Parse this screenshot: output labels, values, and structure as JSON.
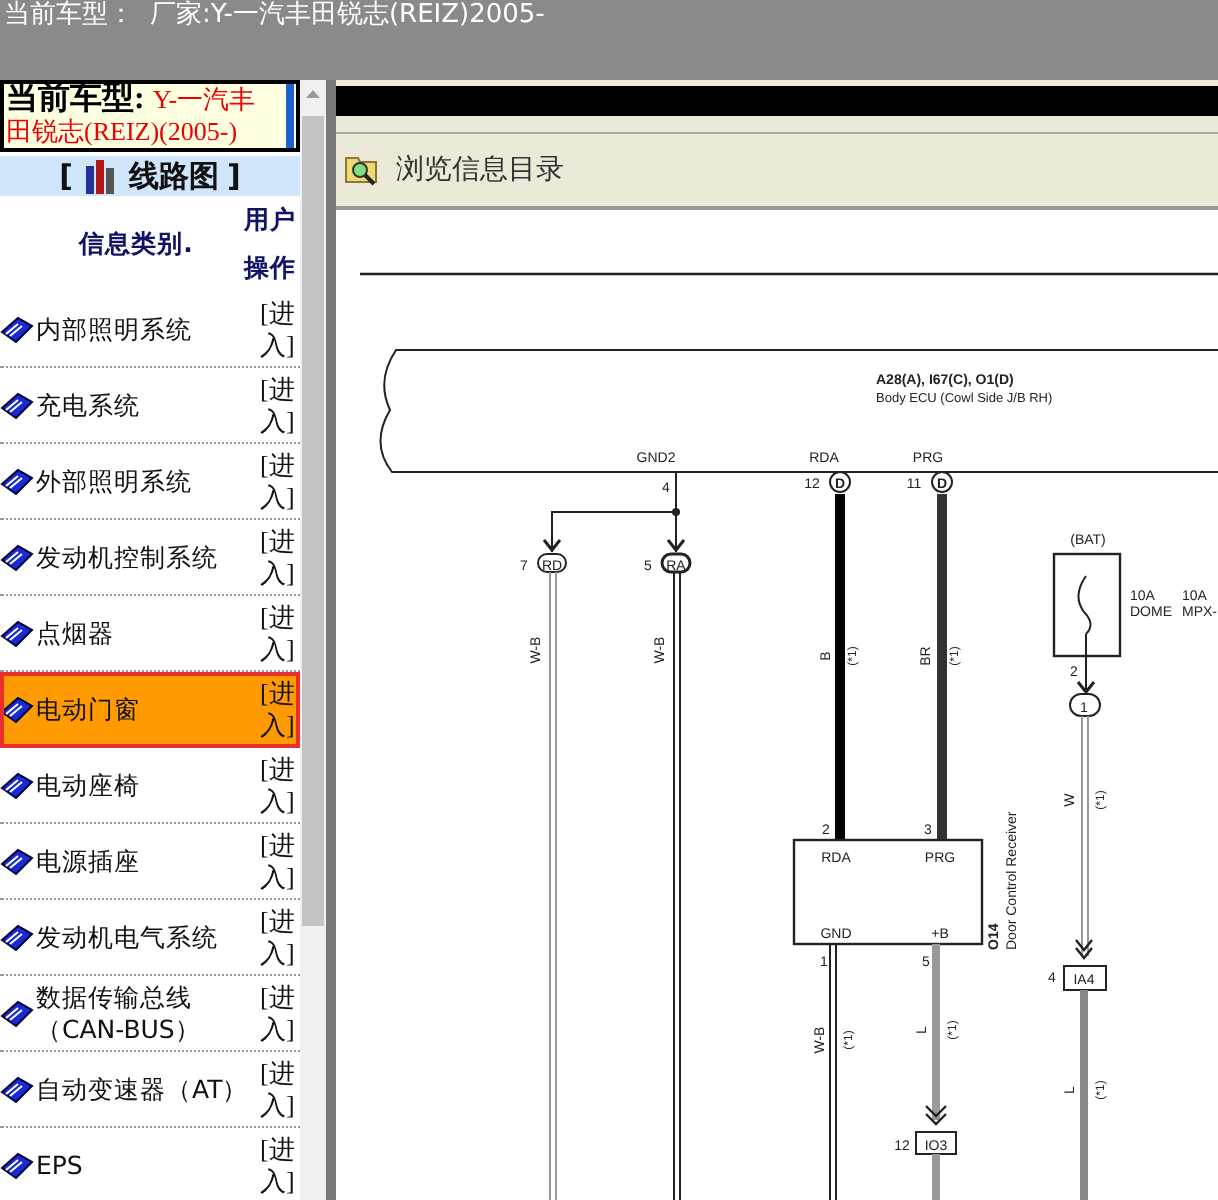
{
  "title_bar": {
    "label": "当前车型：",
    "maker": "厂家:Y-一汽丰田锐志(REIZ)2005-"
  },
  "car_box": {
    "label": "当前车型:",
    "value": "Y-一汽丰田锐志(REIZ)(2005-)"
  },
  "section_title": {
    "open": "[",
    "text": "线路图",
    "close": "]"
  },
  "table": {
    "columns": [
      "信息类别.",
      "用户操作"
    ],
    "rows": [
      {
        "name": "内部照明系统",
        "action": "[进入]",
        "selected": false
      },
      {
        "name": "充电系统",
        "action": "[进入]",
        "selected": false
      },
      {
        "name": "外部照明系统",
        "action": "[进入]",
        "selected": false
      },
      {
        "name": "发动机控制系统",
        "action": "[进入]",
        "selected": false
      },
      {
        "name": "点烟器",
        "action": "[进入]",
        "selected": false
      },
      {
        "name": "电动门窗",
        "action": "[进入]",
        "selected": true
      },
      {
        "name": "电动座椅",
        "action": "[进入]",
        "selected": false
      },
      {
        "name": "电源插座",
        "action": "[进入]",
        "selected": false
      },
      {
        "name": "发动机电气系统",
        "action": "[进入]",
        "selected": false
      },
      {
        "name": "数据传输总线（CAN-BUS）",
        "action": "[进入]",
        "selected": false
      },
      {
        "name": "自动变速器（AT）",
        "action": "[进入]",
        "selected": false
      },
      {
        "name": "EPS",
        "action": "[进入]",
        "selected": false
      }
    ]
  },
  "toolbar": {
    "label": "浏览信息目录"
  },
  "diagram": {
    "labels": [
      "A28(A), I67(C), O1(D)",
      "Body ECU (Cowl Side J/B RH)",
      "GND2",
      "RDA",
      "PRG",
      "4",
      "12",
      "D",
      "11",
      "D",
      "7",
      "RD",
      "5",
      "RA",
      "W-B",
      "W-B",
      "B",
      "(*1)",
      "BR",
      "(*1)",
      "(BAT)",
      "10A",
      "DOME",
      "10A",
      "MPX-",
      "2",
      "1",
      "W",
      "(*1)",
      "2",
      "3",
      "RDA",
      "PRG",
      "GND",
      "+B",
      "O14",
      "Door Control Receiver",
      "1",
      "5",
      "W-B",
      "(*1)",
      "L",
      "(*1)",
      "4",
      "IA4",
      "L",
      "(*1)",
      "12",
      "IO3"
    ]
  }
}
